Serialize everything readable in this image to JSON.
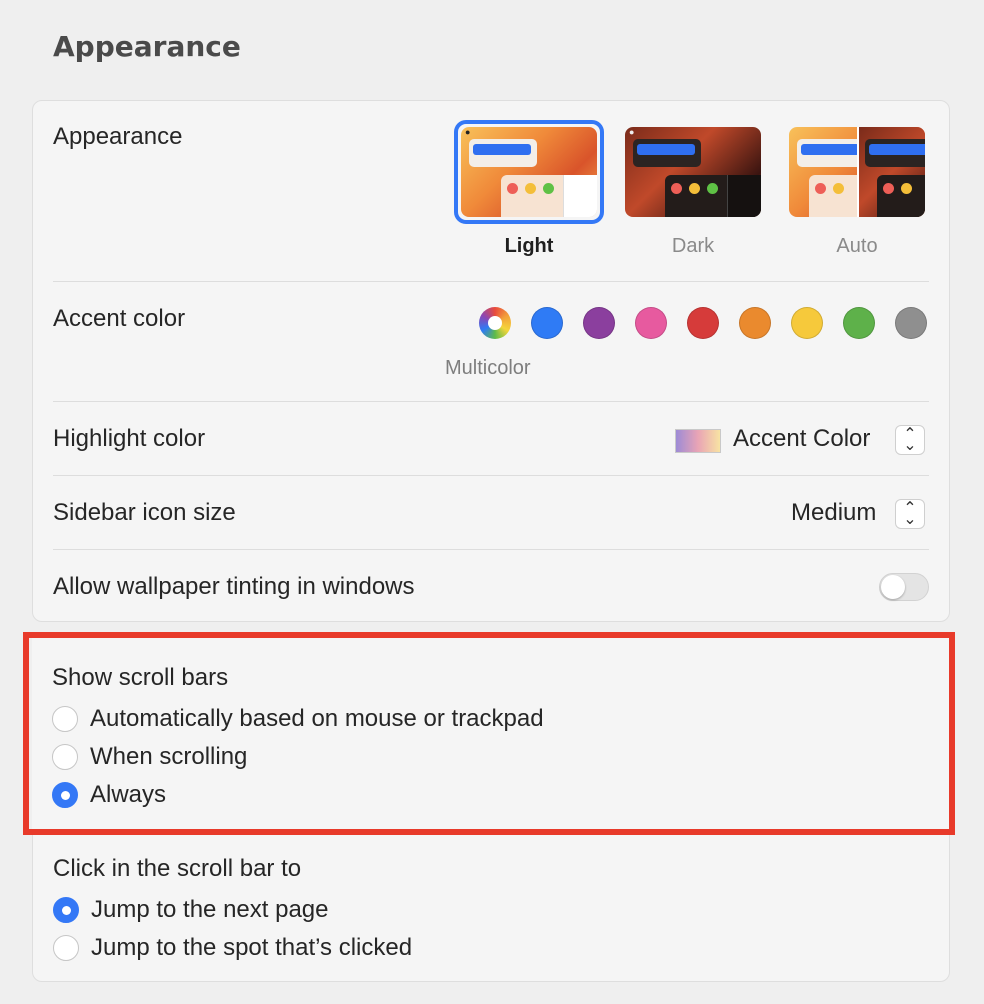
{
  "page_title": "Appearance",
  "appearance": {
    "label": "Appearance",
    "options": [
      {
        "label": "Light",
        "selected": true
      },
      {
        "label": "Dark",
        "selected": false
      },
      {
        "label": "Auto",
        "selected": false
      }
    ]
  },
  "accent": {
    "label": "Accent color",
    "caption": "Multicolor",
    "colors": [
      "multicolor",
      "#2f7bf5",
      "#8b3f9e",
      "#e75a9f",
      "#d63b3a",
      "#ea8a2e",
      "#f6c93b",
      "#5eb14a",
      "#8f8f8f"
    ]
  },
  "highlight": {
    "label": "Highlight color",
    "value": "Accent Color"
  },
  "sidebar_icon": {
    "label": "Sidebar icon size",
    "value": "Medium"
  },
  "wallpaper_tint": {
    "label": "Allow wallpaper tinting in windows",
    "on": false
  },
  "scroll_bars": {
    "label": "Show scroll bars",
    "options": [
      {
        "label": "Automatically based on mouse or trackpad",
        "selected": false
      },
      {
        "label": "When scrolling",
        "selected": false
      },
      {
        "label": "Always",
        "selected": true
      }
    ]
  },
  "scroll_click": {
    "label": "Click in the scroll bar to",
    "options": [
      {
        "label": "Jump to the next page",
        "selected": true
      },
      {
        "label": "Jump to the spot that’s clicked",
        "selected": false
      }
    ]
  }
}
